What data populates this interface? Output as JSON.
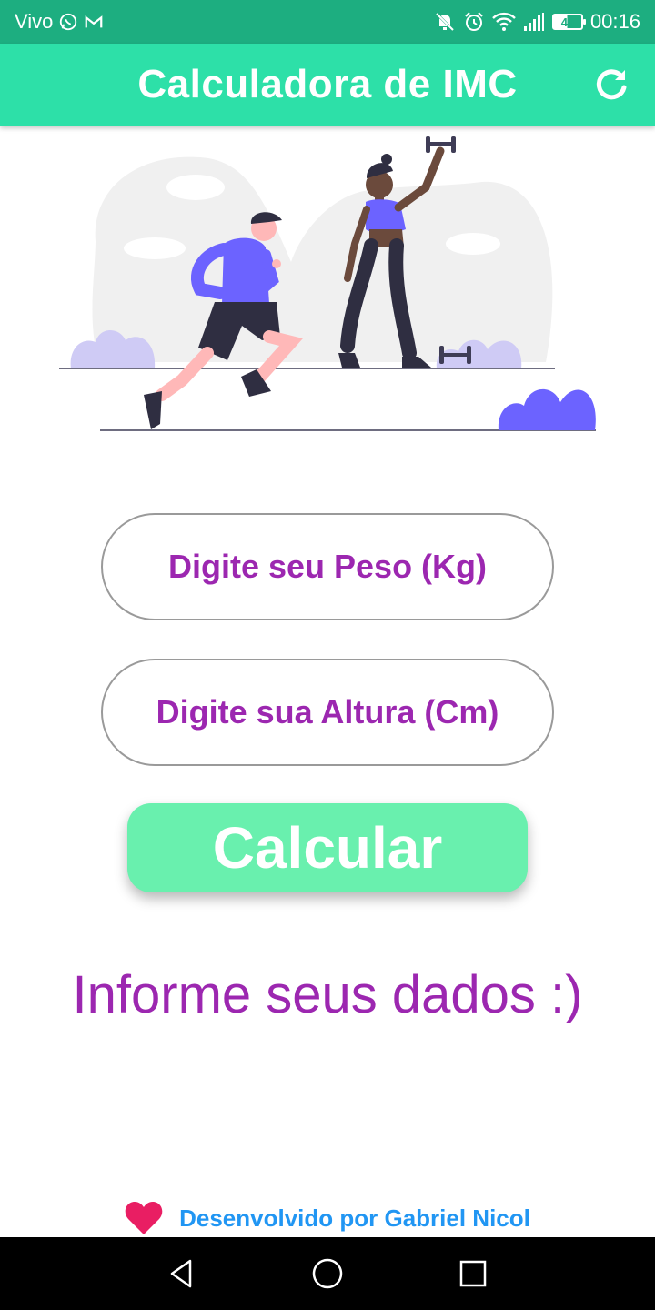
{
  "status_bar": {
    "carrier": "Vivo",
    "battery_level": "49",
    "time": "00:16",
    "icons": [
      "whatsapp-icon",
      "gmail-icon",
      "mute-icon",
      "alarm-icon",
      "wifi-icon",
      "signal-icon",
      "battery-icon"
    ]
  },
  "app_bar": {
    "title": "Calculadora de IMC",
    "refresh_icon": "refresh-icon"
  },
  "form": {
    "weight_placeholder": "Digite seu Peso (Kg)",
    "height_placeholder": "Digite sua Altura (Cm)",
    "calculate_label": "Calcular"
  },
  "result": {
    "text": "Informe seus dados :)"
  },
  "footer": {
    "icon": "heart-icon",
    "text": "Desenvolvido por Gabriel Nicol"
  },
  "nav_bar": {
    "icons": [
      "back-icon",
      "home-icon",
      "recents-icon"
    ]
  },
  "colors": {
    "status_bar": "#1dae80",
    "app_bar": "#2de0a8",
    "accent_purple": "#9c27b0",
    "button_green": "#69f0ae",
    "footer_blue": "#2196f3",
    "heart_red": "#e91e63",
    "illustration_purple": "#6c63ff"
  }
}
